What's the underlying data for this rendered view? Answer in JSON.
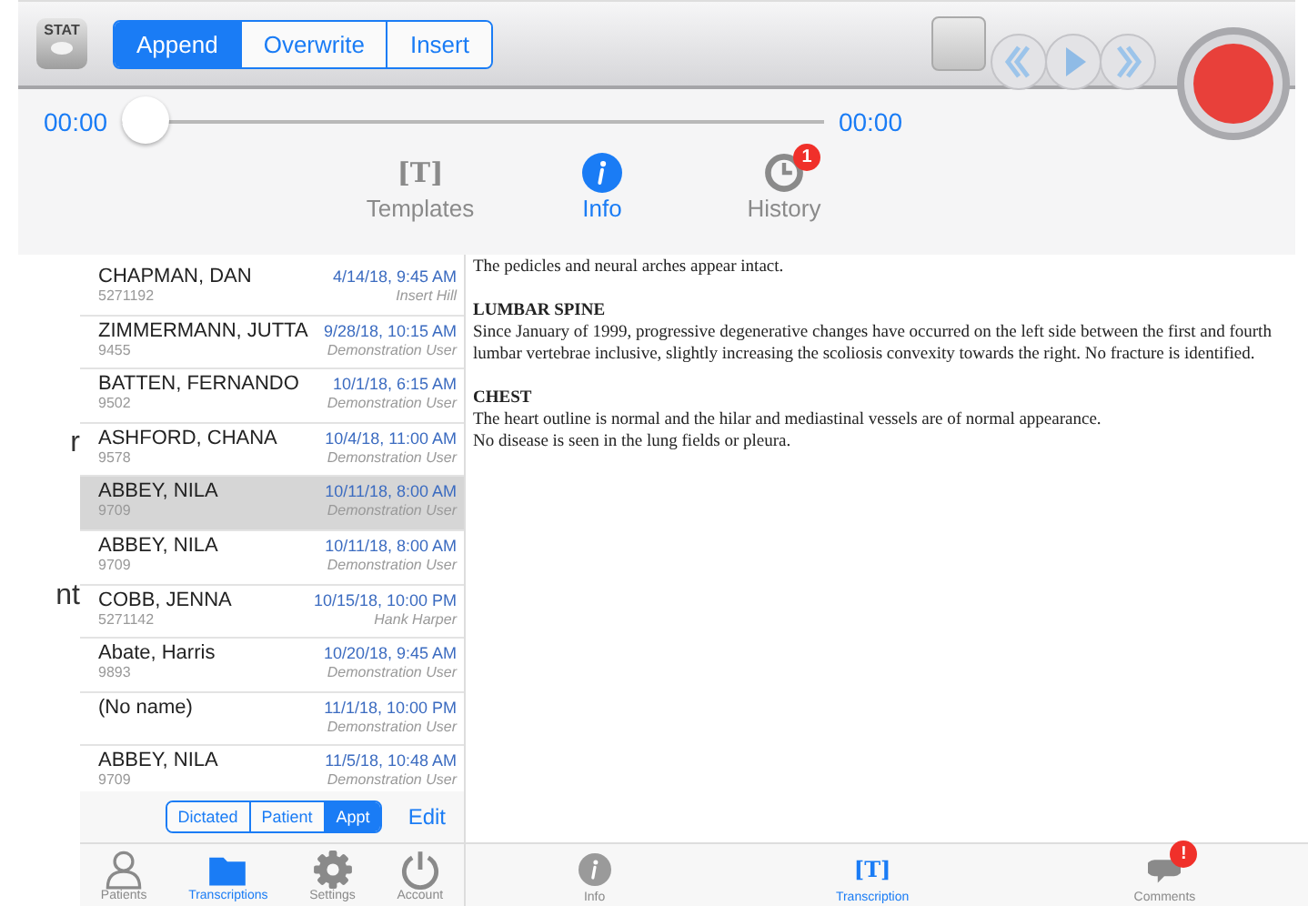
{
  "toolbar": {
    "stat_label": "STAT",
    "modes": [
      {
        "label": "Append",
        "selected": true
      },
      {
        "label": "Overwrite",
        "selected": false
      },
      {
        "label": "Insert",
        "selected": false
      }
    ]
  },
  "slider": {
    "start": "00:00",
    "end": "00:00",
    "level": 0
  },
  "top_tabs": [
    {
      "label": "Templates",
      "kind": "glyph",
      "glyph": "[T]",
      "selected": false
    },
    {
      "label": "Info",
      "kind": "info",
      "selected": true
    },
    {
      "label": "History",
      "kind": "clock",
      "badge": "1",
      "selected": false
    }
  ],
  "background_text": [
    "r",
    "nt"
  ],
  "transcriptions": [
    {
      "name": "CHAPMAN, DAN",
      "id": "5271192",
      "date": "4/14/18, 9:45 AM",
      "author": "Insert Hill",
      "selected": false
    },
    {
      "name": "ZIMMERMANN, JUTTA",
      "id": "9455",
      "date": "9/28/18, 10:15 AM",
      "author": "Demonstration User",
      "selected": false
    },
    {
      "name": "BATTEN, FERNANDO",
      "id": "9502",
      "date": "10/1/18, 6:15 AM",
      "author": "Demonstration User",
      "selected": false
    },
    {
      "name": "ASHFORD, CHANA",
      "id": "9578",
      "date": "10/4/18, 11:00 AM",
      "author": "Demonstration User",
      "selected": false
    },
    {
      "name": "ABBEY, NILA",
      "id": "9709",
      "date": "10/11/18, 8:00 AM",
      "author": "Demonstration User",
      "selected": true
    },
    {
      "name": "ABBEY, NILA",
      "id": "9709",
      "date": "10/11/18, 8:00 AM",
      "author": "Demonstration User",
      "selected": false
    },
    {
      "name": "COBB, JENNA",
      "id": "5271142",
      "date": "10/15/18, 10:00 PM",
      "author": "Hank Harper",
      "selected": false
    },
    {
      "name": "Abate, Harris",
      "id": "9893",
      "date": "10/20/18, 9:45 AM",
      "author": "Demonstration User",
      "selected": false
    },
    {
      "name": "(No name)",
      "date": "11/1/18, 10:00 PM",
      "author": "Demonstration User",
      "selected": false
    },
    {
      "name": "ABBEY, NILA",
      "id": "9709",
      "date": "11/5/18, 10:48 AM",
      "author": "Demonstration User",
      "selected": false
    }
  ],
  "sort": [
    {
      "label": "Dictated",
      "selected": false
    },
    {
      "label": "Patient",
      "selected": false
    },
    {
      "label": "Appt",
      "selected": true
    }
  ],
  "edit_label": "Edit",
  "left_tabs": [
    {
      "label": "Patients",
      "kind": "person",
      "selected": false
    },
    {
      "label": "Transcriptions",
      "kind": "folder",
      "selected": true
    },
    {
      "label": "Settings",
      "kind": "gear",
      "selected": false
    },
    {
      "label": "Account",
      "kind": "power",
      "selected": false
    }
  ],
  "document": [
    {
      "lines": [
        "The pedicles and neural arches appear intact."
      ]
    },
    {
      "heading": "LUMBAR SPINE",
      "lines": [
        "Since January of 1999, progressive degenerative changes have occurred on the left side between the first and fourth lumbar vertebrae inclusive, slightly increasing the scoliosis convexity towards the right. No fracture is identified."
      ]
    },
    {
      "heading": "CHEST",
      "lines": [
        "The heart outline is normal and the hilar and mediastinal vessels are of normal appearance.",
        "No disease is seen in the lung fields or pleura."
      ]
    }
  ],
  "right_tabs": [
    {
      "label": "Info",
      "kind": "info",
      "selected": false
    },
    {
      "label": "Transcription",
      "kind": "glyph",
      "glyph": "[T]",
      "selected": true
    },
    {
      "label": "Comments",
      "kind": "bubble",
      "badge": "!",
      "selected": false
    }
  ]
}
